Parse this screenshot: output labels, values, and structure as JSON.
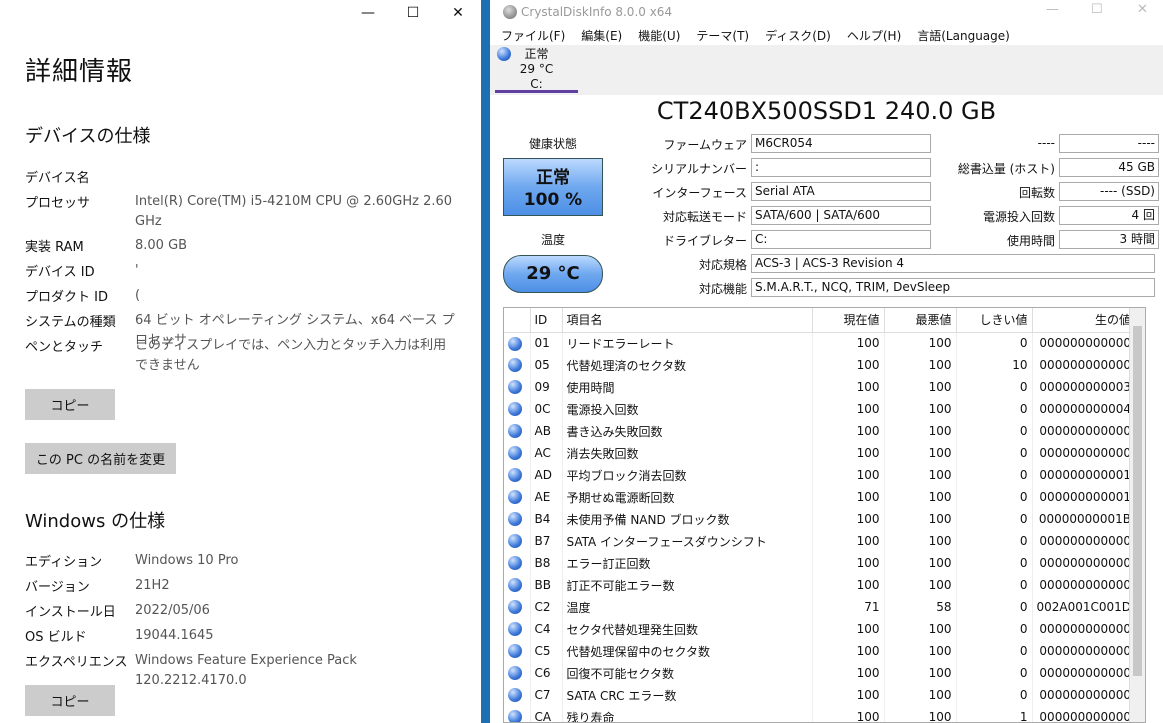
{
  "settings": {
    "title": "詳細情報",
    "device_section": "デバイスの仕様",
    "device_specs": [
      {
        "key": "デバイス名",
        "value": ""
      },
      {
        "key": "プロセッサ",
        "value": "Intel(R) Core(TM) i5-4210M CPU @ 2.60GHz   2.60 GHz"
      },
      {
        "key": "実装 RAM",
        "value": "8.00 GB"
      },
      {
        "key": "デバイス ID",
        "value": "'"
      },
      {
        "key": "プロダクト ID",
        "value": "("
      },
      {
        "key": "システムの種類",
        "value": "64 ビット オペレーティング システム、x64 ベース プロセッサ"
      },
      {
        "key": "ペンとタッチ",
        "value": "このディスプレイでは、ペン入力とタッチ入力は利用できません"
      }
    ],
    "copy_button": "コピー",
    "rename_button": "この PC の名前を変更",
    "windows_section": "Windows の仕様",
    "windows_specs": [
      {
        "key": "エディション",
        "value": "Windows 10 Pro"
      },
      {
        "key": "バージョン",
        "value": "21H2"
      },
      {
        "key": "インストール日",
        "value": "2022/05/06"
      },
      {
        "key": "OS ビルド",
        "value": "19044.1645"
      },
      {
        "key": "エクスペリエンス",
        "value": "Windows Feature Experience Pack 120.2212.4170.0"
      }
    ],
    "copy_button2": "コピー",
    "controls": {
      "minimize": "—",
      "maximize": "☐",
      "close": "✕"
    }
  },
  "cdi": {
    "title": "CrystalDiskInfo 8.0.0 x64",
    "menu": [
      "ファイル(F)",
      "編集(E)",
      "機能(U)",
      "テーマ(T)",
      "ディスク(D)",
      "ヘルプ(H)",
      "言語(Language)"
    ],
    "disk_tab": {
      "status": "正常",
      "temp": "29 °C",
      "drive": "C:"
    },
    "model": "CT240BX500SSD1 240.0 GB",
    "health_label": "健康状態",
    "health_status": "正常",
    "health_percent": "100 %",
    "temp_label": "温度",
    "temp_value": "29 °C",
    "info": {
      "firmware_label": "ファームウェア",
      "firmware": "M6CR054",
      "serial_label": "シリアルナンバー",
      "serial": ":",
      "interface_label": "インターフェース",
      "interface": "Serial ATA",
      "transfer_label": "対応転送モード",
      "transfer": "SATA/600 | SATA/600",
      "drive_letter_label": "ドライブレター",
      "drive_letter": "C:",
      "standard_label": "対応規格",
      "standard": "ACS-3 | ACS-3 Revision 4",
      "features_label": "対応機能",
      "features": "S.M.A.R.T., NCQ, TRIM, DevSleep",
      "blank_label": "----",
      "blank_value": "----",
      "host_writes_label": "総書込量 (ホスト)",
      "host_writes": "45 GB",
      "rotation_label": "回転数",
      "rotation": "---- (SSD)",
      "power_count_label": "電源投入回数",
      "power_count": "4 回",
      "power_hours_label": "使用時間",
      "power_hours": "3 時間"
    },
    "smart_headers": [
      "ID",
      "項目名",
      "現在値",
      "最悪値",
      "しきい値",
      "生の値"
    ],
    "smart_rows": [
      [
        "01",
        "リードエラーレート",
        "100",
        "100",
        "0",
        "000000000000"
      ],
      [
        "05",
        "代替処理済のセクタ数",
        "100",
        "100",
        "10",
        "000000000000"
      ],
      [
        "09",
        "使用時間",
        "100",
        "100",
        "0",
        "000000000003"
      ],
      [
        "0C",
        "電源投入回数",
        "100",
        "100",
        "0",
        "000000000004"
      ],
      [
        "AB",
        "書き込み失敗回数",
        "100",
        "100",
        "0",
        "000000000000"
      ],
      [
        "AC",
        "消去失敗回数",
        "100",
        "100",
        "0",
        "000000000000"
      ],
      [
        "AD",
        "平均ブロック消去回数",
        "100",
        "100",
        "0",
        "000000000001"
      ],
      [
        "AE",
        "予期せぬ電源断回数",
        "100",
        "100",
        "0",
        "000000000001"
      ],
      [
        "B4",
        "未使用予備 NAND ブロック数",
        "100",
        "100",
        "0",
        "00000000001B"
      ],
      [
        "B7",
        "SATA インターフェースダウンシフト",
        "100",
        "100",
        "0",
        "000000000000"
      ],
      [
        "B8",
        "エラー訂正回数",
        "100",
        "100",
        "0",
        "000000000000"
      ],
      [
        "BB",
        "訂正不可能エラー数",
        "100",
        "100",
        "0",
        "000000000000"
      ],
      [
        "C2",
        "温度",
        "71",
        "58",
        "0",
        "002A001C001D"
      ],
      [
        "C4",
        "セクタ代替処理発生回数",
        "100",
        "100",
        "0",
        "000000000000"
      ],
      [
        "C5",
        "代替処理保留中のセクタ数",
        "100",
        "100",
        "0",
        "000000000000"
      ],
      [
        "C6",
        "回復不可能セクタ数",
        "100",
        "100",
        "0",
        "000000000000"
      ],
      [
        "C7",
        "SATA CRC エラー数",
        "100",
        "100",
        "0",
        "000000000000"
      ],
      [
        "CA",
        "残り寿命",
        "100",
        "100",
        "1",
        "000000000000"
      ]
    ],
    "controls": {
      "minimize": "—",
      "maximize": "☐",
      "close": "✕"
    }
  }
}
